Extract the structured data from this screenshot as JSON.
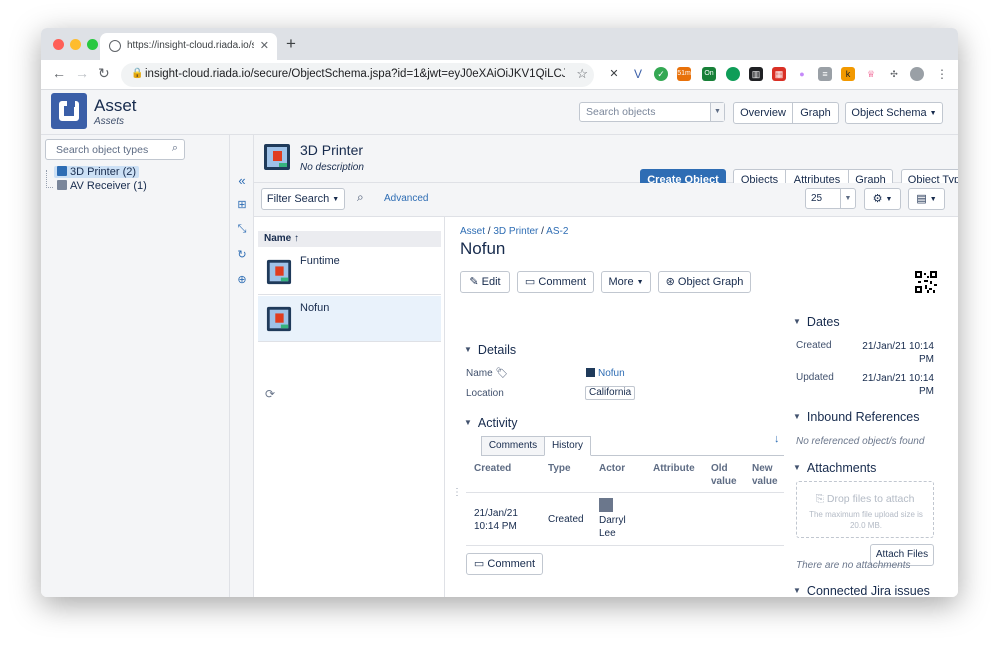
{
  "browser": {
    "tab_title": "https://insight-cloud.riada.io/s",
    "url": "insight-cloud.riada.io/secure/ObjectSchema.jspa?id=1&jwt=eyJ0eXAiOiJKV1QiLCJhbGc...",
    "extension_badges": [
      "51m",
      "On"
    ]
  },
  "app": {
    "name": "Asset",
    "subtitle": "Assets",
    "search_placeholder": "Search objects",
    "nav": {
      "overview": "Overview",
      "graph": "Graph",
      "object_schema": "Object Schema"
    }
  },
  "sidebar": {
    "search_placeholder": "Search object types",
    "tree": [
      {
        "label": "3D Printer (2)",
        "selected": true
      },
      {
        "label": "AV Receiver (1)",
        "selected": false
      }
    ]
  },
  "object_type": {
    "title": "3D Printer",
    "description": "No description",
    "create_button": "Create Object",
    "tabs": [
      "Objects",
      "Attributes",
      "Graph"
    ],
    "object_type_menu": "Object Type"
  },
  "filter": {
    "filter_search": "Filter Search",
    "advanced": "Advanced",
    "page_size": "25"
  },
  "list": {
    "column_header": "Name",
    "items": [
      {
        "name": "Funtime",
        "active": false
      },
      {
        "name": "Nofun",
        "active": true
      }
    ]
  },
  "detail": {
    "breadcrumb": [
      "Asset",
      "3D Printer",
      "AS-2"
    ],
    "title": "Nofun",
    "actions": {
      "edit": "Edit",
      "comment": "Comment",
      "more": "More",
      "object_graph": "Object Graph"
    },
    "details": {
      "heading": "Details",
      "name_label": "Name",
      "name_value": "Nofun",
      "location_label": "Location",
      "location_value": "California"
    },
    "activity": {
      "heading": "Activity",
      "tabs": [
        "Comments",
        "History"
      ],
      "columns": {
        "created": "Created",
        "type": "Type",
        "actor": "Actor",
        "attribute": "Attribute",
        "old_value": "Old value",
        "new_value": "New value"
      },
      "rows": [
        {
          "created": "21/Jan/21 10:14 PM",
          "type": "Created",
          "actor": "Darryl Lee",
          "attribute": "",
          "old_value": "",
          "new_value": ""
        }
      ],
      "comment_button": "Comment"
    },
    "dates": {
      "heading": "Dates",
      "created_label": "Created",
      "created_value": "21/Jan/21 10:14 PM",
      "updated_label": "Updated",
      "updated_value": "21/Jan/21 10:14 PM"
    },
    "inbound": {
      "heading": "Inbound References",
      "empty": "No referenced object/s found"
    },
    "attachments": {
      "heading": "Attachments",
      "drop": "Drop files to attach",
      "limit": "The maximum file upload size is 20.0 MB.",
      "attach_button": "Attach Files",
      "empty": "There are no attachments"
    },
    "jira": {
      "heading": "Connected Jira issues"
    }
  },
  "colors": {
    "primary": "#2e6db4",
    "panel": "#f4f5f7",
    "chrome": "#dee1e6"
  }
}
